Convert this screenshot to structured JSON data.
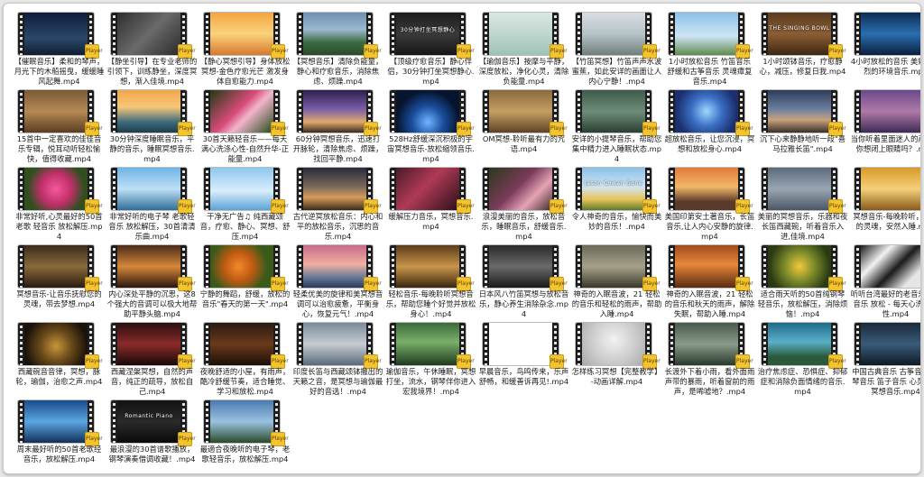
{
  "files": [
    {
      "name": "【催眠音乐】柔和的琴声，月光下的木船摇曳，缓缓睡风起舞.mp4",
      "bg": "linear-gradient(#0e1c3a,#2a4868 60%,#0f1e33)",
      "icon": "video-file-icon"
    },
    {
      "name": "【静坐引导】在专业老师的引领下，训练静坐，深度冥想，渐入佳境.mp4",
      "bg": "linear-gradient(135deg,#2e2e2e,#6a6a6a 50%,#2a2a2a)",
      "icon": "video-file-icon"
    },
    {
      "name": "【静心冥想引导】身体放松冥想-金色疗愈光芒 激发身体自愈能力.mp4",
      "bg": "linear-gradient(#f3a640,#f9d27b 50%,#d67a2e)",
      "icon": "video-file-icon"
    },
    {
      "name": "【冥想音乐】清除负能量，静心和疗愈音乐，消除焦虑、烦躁.mp4",
      "bg": "linear-gradient(#6e8fb3,#9bbad0 40%,#3c6b3f 70%,#2b4a2a)",
      "icon": "video-file-icon"
    },
    {
      "name": "【顶级疗愈音乐】静心伴侣，30分钟打坐冥想静心.mp4",
      "bg": "linear-gradient(#1c1c1c,#3a3a3a 50%,#161616)",
      "icon": "video-file-icon",
      "overlay": "30分钟打坐冥想静心"
    },
    {
      "name": "【瑜伽音乐】按摩与平静，深度放松，净化心灵，清除负能量.mp4",
      "bg": "linear-gradient(#d9e8e2,#bfd7cf 50%,#9fc2b5)",
      "icon": "video-file-icon"
    },
    {
      "name": "【竹笛冥想】竹笛声声水波蜜蕉，如此安详的画面让人内心宁静！.mp4",
      "bg": "linear-gradient(#d8dde0,#b7c3c9 50%,#6f7f7a)",
      "icon": "video-file-icon"
    },
    {
      "name": "1小时放松音乐 竹笛音乐 舒缓和古筝音乐 灵魂瘴复音乐.mp4",
      "bg": "linear-gradient(#8ac0e8,#cfe6f4 55%,#5f8a4f)",
      "icon": "video-file-icon"
    },
    {
      "name": "1小时颂钵音乐，疗愈静心，减压，修复日我.mp4",
      "bg": "linear-gradient(#5a3b1f,#8b5e33 50%,#3d2713)",
      "icon": "video-file-icon",
      "overlay": "THE SINGING BOWL"
    },
    {
      "name": "4小时放松的音乐 美妙而放烈的环境音乐.mp4",
      "bg": "linear-gradient(#0d2b55,#2a6fb0 50%,#0b1f3f)",
      "icon": "video-file-icon"
    },
    {
      "name": "15首中一定喜欢的佳佳音乐专辑，悦耳动听轻松愉快，值得收藏.mp4",
      "bg": "linear-gradient(#7a5a36,#b58955 50%,#5a3d22)",
      "icon": "video-file-icon"
    },
    {
      "name": "30分钟深度睡眠音乐，平静的音乐，睡眠冥想音乐.mp4",
      "bg": "linear-gradient(#f2a64a,#f6c77a 40%,#3c6b7b 75%,#1f3d4a)",
      "icon": "video-file-icon"
    },
    {
      "name": "30首天籁轻音乐——每天满心洗涤心性-自然升华-正能量.mp4",
      "bg": "linear-gradient(135deg,#1f3b14,#d94c7a 45%,#f2b5cd 60%,#234a16)",
      "icon": "video-file-icon"
    },
    {
      "name": "60分钟冥想音乐，迅速打开脉轮，清除焦虑、烦躁，找回平静.mp4",
      "bg": "linear-gradient(#2c1e4d,#7b5fa8 45%,#e0a96c 75%,#3a2a1f)",
      "icon": "video-file-icon"
    },
    {
      "name": "528Hz舒缓深沉积极的宇宙冥想音乐-放松缩领音乐.mp4",
      "bg": "radial-gradient(circle at 50% 75%,#6fb5ff,#1a4f9e 35%,#06142e 70%)",
      "icon": "video-file-icon"
    },
    {
      "name": "OM冥想-聆听最有力的咒语.mp4",
      "bg": "linear-gradient(#8a6a3d,#c69e62 50%,#5d4325)",
      "icon": "video-file-icon"
    },
    {
      "name": "安详的小提琴音乐，帮助您集中精力进入睡眠状态.mp4",
      "bg": "linear-gradient(#3d5a4a,#6f8d7a 50%,#2a3f33)",
      "icon": "video-file-icon"
    },
    {
      "name": "超放松音乐，让您沉浸，冥想和放松身心.mp4",
      "bg": "radial-gradient(circle at 50% 50%,#9fd6ff,#3a6fc4 40%,#1b2f6e 80%)",
      "icon": "video-file-icon"
    },
    {
      "name": "沉下心来静静地听一段\"喜马拉雅长笛\".mp4",
      "bg": "linear-gradient(#2d3b58,#6c7fa0 45%,#c9a27c 70%,#3a2f2a)",
      "icon": "video-file-icon"
    },
    {
      "name": "当你听着里面迷人的声音，你想闭上眼睛吗？.mp4",
      "bg": "linear-gradient(#6a4a8c,#b07aa7 50%,#3d2a55)",
      "icon": "video-file-icon"
    },
    {
      "name": "非常好听,心灵最好的50首老歌 轻音乐 放松解压.mp4",
      "bg": "radial-gradient(circle at 50% 50%,#f25a9a,#c12f6a 40%,#2f4f1f 75%)",
      "icon": "video-file-icon"
    },
    {
      "name": "非常好听的电子琴 老歌轻音乐 放松解压，30首清清乐曲.mp4",
      "bg": "linear-gradient(#6fb3e6,#bfe0f5 50%,#2f6e9a)",
      "icon": "video-file-icon"
    },
    {
      "name": "干净无广告♫ 纯西藏颂音，疗愈、静心、冥想、舒压.mp4",
      "bg": "linear-gradient(#8ec8ef,#d9eefa 55%,#5aa3d6)",
      "icon": "video-file-icon"
    },
    {
      "name": "古代逆冥放松音乐：内心和平的放松音乐，沉思的音乐.mp4",
      "bg": "linear-gradient(#2a2a3a,#7a6a5a 45%,#d69a5a 70%,#3a2a1a)",
      "icon": "video-file-icon"
    },
    {
      "name": "缓解压力音乐，冥想音乐.mp4",
      "bg": "linear-gradient(135deg,#4a1a2a,#b03a55 45%,#2a0f1a)",
      "icon": "video-file-icon"
    },
    {
      "name": "浪漫美丽的音乐，放松音乐，睡眠音乐，舒缓音乐.mp4",
      "bg": "linear-gradient(135deg,#2a3a1a,#7a3a5a 45%,#e6a3b5 70%,#3a2a2a)",
      "icon": "video-file-icon"
    },
    {
      "name": "令人神奇的音乐，愉快而美妙的音乐！.mp4",
      "bg": "linear-gradient(#8ac0e8,#d0e6f2 45%,#e8c258 75%,#5a7a2a)",
      "icon": "video-file-icon",
      "overlay": "Jason Cowan Gone"
    },
    {
      "name": "美国印第安土著音乐，长笛音乐,让人内心安静的旋律.mp4",
      "bg": "linear-gradient(#e07a3a,#f2b86a 45%,#5a3a2a 80%)",
      "icon": "video-file-icon"
    },
    {
      "name": "美丽的冥想音乐，乐器和夜长笛西藏碗，听着音乐入进,佳境.mp4",
      "bg": "linear-gradient(#5a6a7a,#9aa6b2 50%,#4a5664)",
      "icon": "video-file-icon"
    },
    {
      "name": "冥想音乐-每晚聆听，纯净的灵魂，安然入睡.mp4",
      "bg": "linear-gradient(#d69a2a,#f5d07a 50%,#8a5a1a)",
      "icon": "video-file-icon"
    },
    {
      "name": "冥想音乐-让音乐抚慰您的灵魂，带去梦想.mp4",
      "bg": "linear-gradient(#3a2a1a,#8a6a3a 50%,#2a1a0f)",
      "icon": "video-file-icon"
    },
    {
      "name": "内心深处平静的沉思，这8个强大的音调可以极大地帮助平静头脑.mp4",
      "bg": "linear-gradient(#4a2a1a,#d6883a 50%,#2a160c)",
      "icon": "video-file-icon"
    },
    {
      "name": "宁静的舞蹈，舒缓，放松的音乐\"春天的第一天\".mp4",
      "bg": "radial-gradient(circle at 45% 50%,#f28a2a,#c05a12 35%,#3a5a1a 70%)",
      "icon": "video-file-icon"
    },
    {
      "name": "轻柔优美的旋律和美冥想音调可以治愈疲惫，平衡身心，恢复元气！.mp4",
      "bg": "linear-gradient(#c86a8a,#f0b0a0 45%,#6a7a9a 75%,#2a3a5a)",
      "icon": "video-file-icon"
    },
    {
      "name": "轻松音乐-每晚聆听冥想音乐，帮助您睡个好觉并放松身心！.mp4",
      "bg": "linear-gradient(#5a3a1a,#c8964a 50%,#3a260f)",
      "icon": "video-file-icon"
    },
    {
      "name": "日本风八竹笛冥想与放松音乐，静心养生消除杂念.mp4",
      "bg": "linear-gradient(#2a2a2a,#6a6a6a 50%,#1a1a1a)",
      "icon": "video-file-icon"
    },
    {
      "name": "神奇的入眠音波，21 轻松的音乐和轻松的雨声，帮助入睡.mp4",
      "bg": "linear-gradient(#6a6a5a,#a6a28a 50%,#3a382a)",
      "icon": "video-file-icon"
    },
    {
      "name": "神奇的入眠音波，21 轻松的音乐和秋天的雨声，解除失眠，帮助入睡.mp4",
      "bg": "linear-gradient(#a04a1a,#e6883a 45%,#5a2a0f)",
      "icon": "video-file-icon"
    },
    {
      "name": "适合雨天听的50首纯钢琴轻音乐，放松解压，消除烦恼！.mp4",
      "bg": "radial-gradient(circle at 50% 50%,#f2c83a,#7a8a2a 40%,#2a3a12 80%)",
      "icon": "video-file-icon"
    },
    {
      "name": "听听台湾最好的老音乐，轻音乐 放松 - 每天心洗涤心性.mp4",
      "bg": "linear-gradient(135deg,#1a1a1a,#f2f2f2 30%,#1a1a1a 55%,#e6e6e6 80%)",
      "icon": "video-file-icon"
    },
    {
      "name": "西藏碗音音律，冥想，脉轮，瑜伽，治愈之声.mp4",
      "bg": "radial-gradient(circle at 50% 55%,#c8963a,#6a4a1a 40%,#1a120a 80%)",
      "icon": "video-file-icon"
    },
    {
      "name": "西藏涅槃冥想，自然的声音，纯正的疏导，放松自己.mp4",
      "bg": "linear-gradient(#2a0f0f,#8a2a2a 50%,#1a0808)",
      "icon": "video-file-icon"
    },
    {
      "name": "夜晚舒适的小屋，有雨声，酷冷舒缓节奏，适合睡觉、学习和放松.mp4",
      "bg": "linear-gradient(#2a1a12,#6a3a1a 50%,#1a0f08)",
      "icon": "video-file-icon"
    },
    {
      "name": "印度长笛与西藏颂钵撒出的天籁之音，是冥想与瑜伽最好的音选！.mp4",
      "bg": "linear-gradient(#7a8a9a,#c6ccd2 50%,#5a6a7a)",
      "icon": "video-file-icon"
    },
    {
      "name": "瑜伽音乐，午休睡眠，冥想打坐，流水，钢琴伴你进入宏我境界！.mp4",
      "bg": "linear-gradient(#3a6a3a,#7ab06a 45%,#1f3a1f)",
      "icon": "video-file-icon"
    },
    {
      "name": "早晨音乐，鸟鸣传来，乐声舒畅，和缓善诉再见!.mp4",
      "bg": "linear-gradient(#ffffff,#ffffff)",
      "icon": "video-file-icon"
    },
    {
      "name": "怎样练习冥想【完整教学】-动画详解.mp4",
      "bg": "radial-gradient(circle at 50% 40%,#f2f2f2,#c8c8c8 60%,#a8a8a8)",
      "icon": "video-file-icon"
    },
    {
      "name": "长渡外下着小雨，看外面雨声带的暴雨，听着窗前的雨声，是唏嘘地？.mp4",
      "bg": "linear-gradient(#4a5a4a,#8a9a8a 50%,#2a3a2a)",
      "icon": "video-file-icon"
    },
    {
      "name": "治疗焦虑症、恐惧症、抑郁症和消除负面情绪的音乐.mp4",
      "bg": "linear-gradient(#1f6a8a,#5ab0c8 45%,#2a5a3a 80%)",
      "icon": "video-file-icon"
    },
    {
      "name": "中国古典音乐 古筝音乐 古琴音乐 笛子音乐 心灵音乐 冥想音乐.mp4",
      "bg": "linear-gradient(#1a2a3a,#3a5a7a 50%,#0f1a24)",
      "icon": "video-file-icon"
    },
    {
      "name": "周末最好听的50首老歌经音乐，放松解压.mp4",
      "bg": "linear-gradient(#1a4a8a,#5aa6e0 50%,#12305a)",
      "icon": "video-file-icon"
    },
    {
      "name": "最浪漫的30首谱歌播放，钢琴演奏借调收藏！.mp4",
      "bg": "linear-gradient(#111,#2a2a2a 50%,#0a0a0a)",
      "icon": "video-file-icon",
      "overlay": "Romantic Piano"
    },
    {
      "name": "最適合夜晚听的电子琴，老歌轻音乐，放松解压.mp4",
      "bg": "linear-gradient(#4a7ab0,#9ac2e0 50%,#2a4a2a)",
      "icon": "video-file-icon"
    }
  ],
  "badge_label": "Player"
}
